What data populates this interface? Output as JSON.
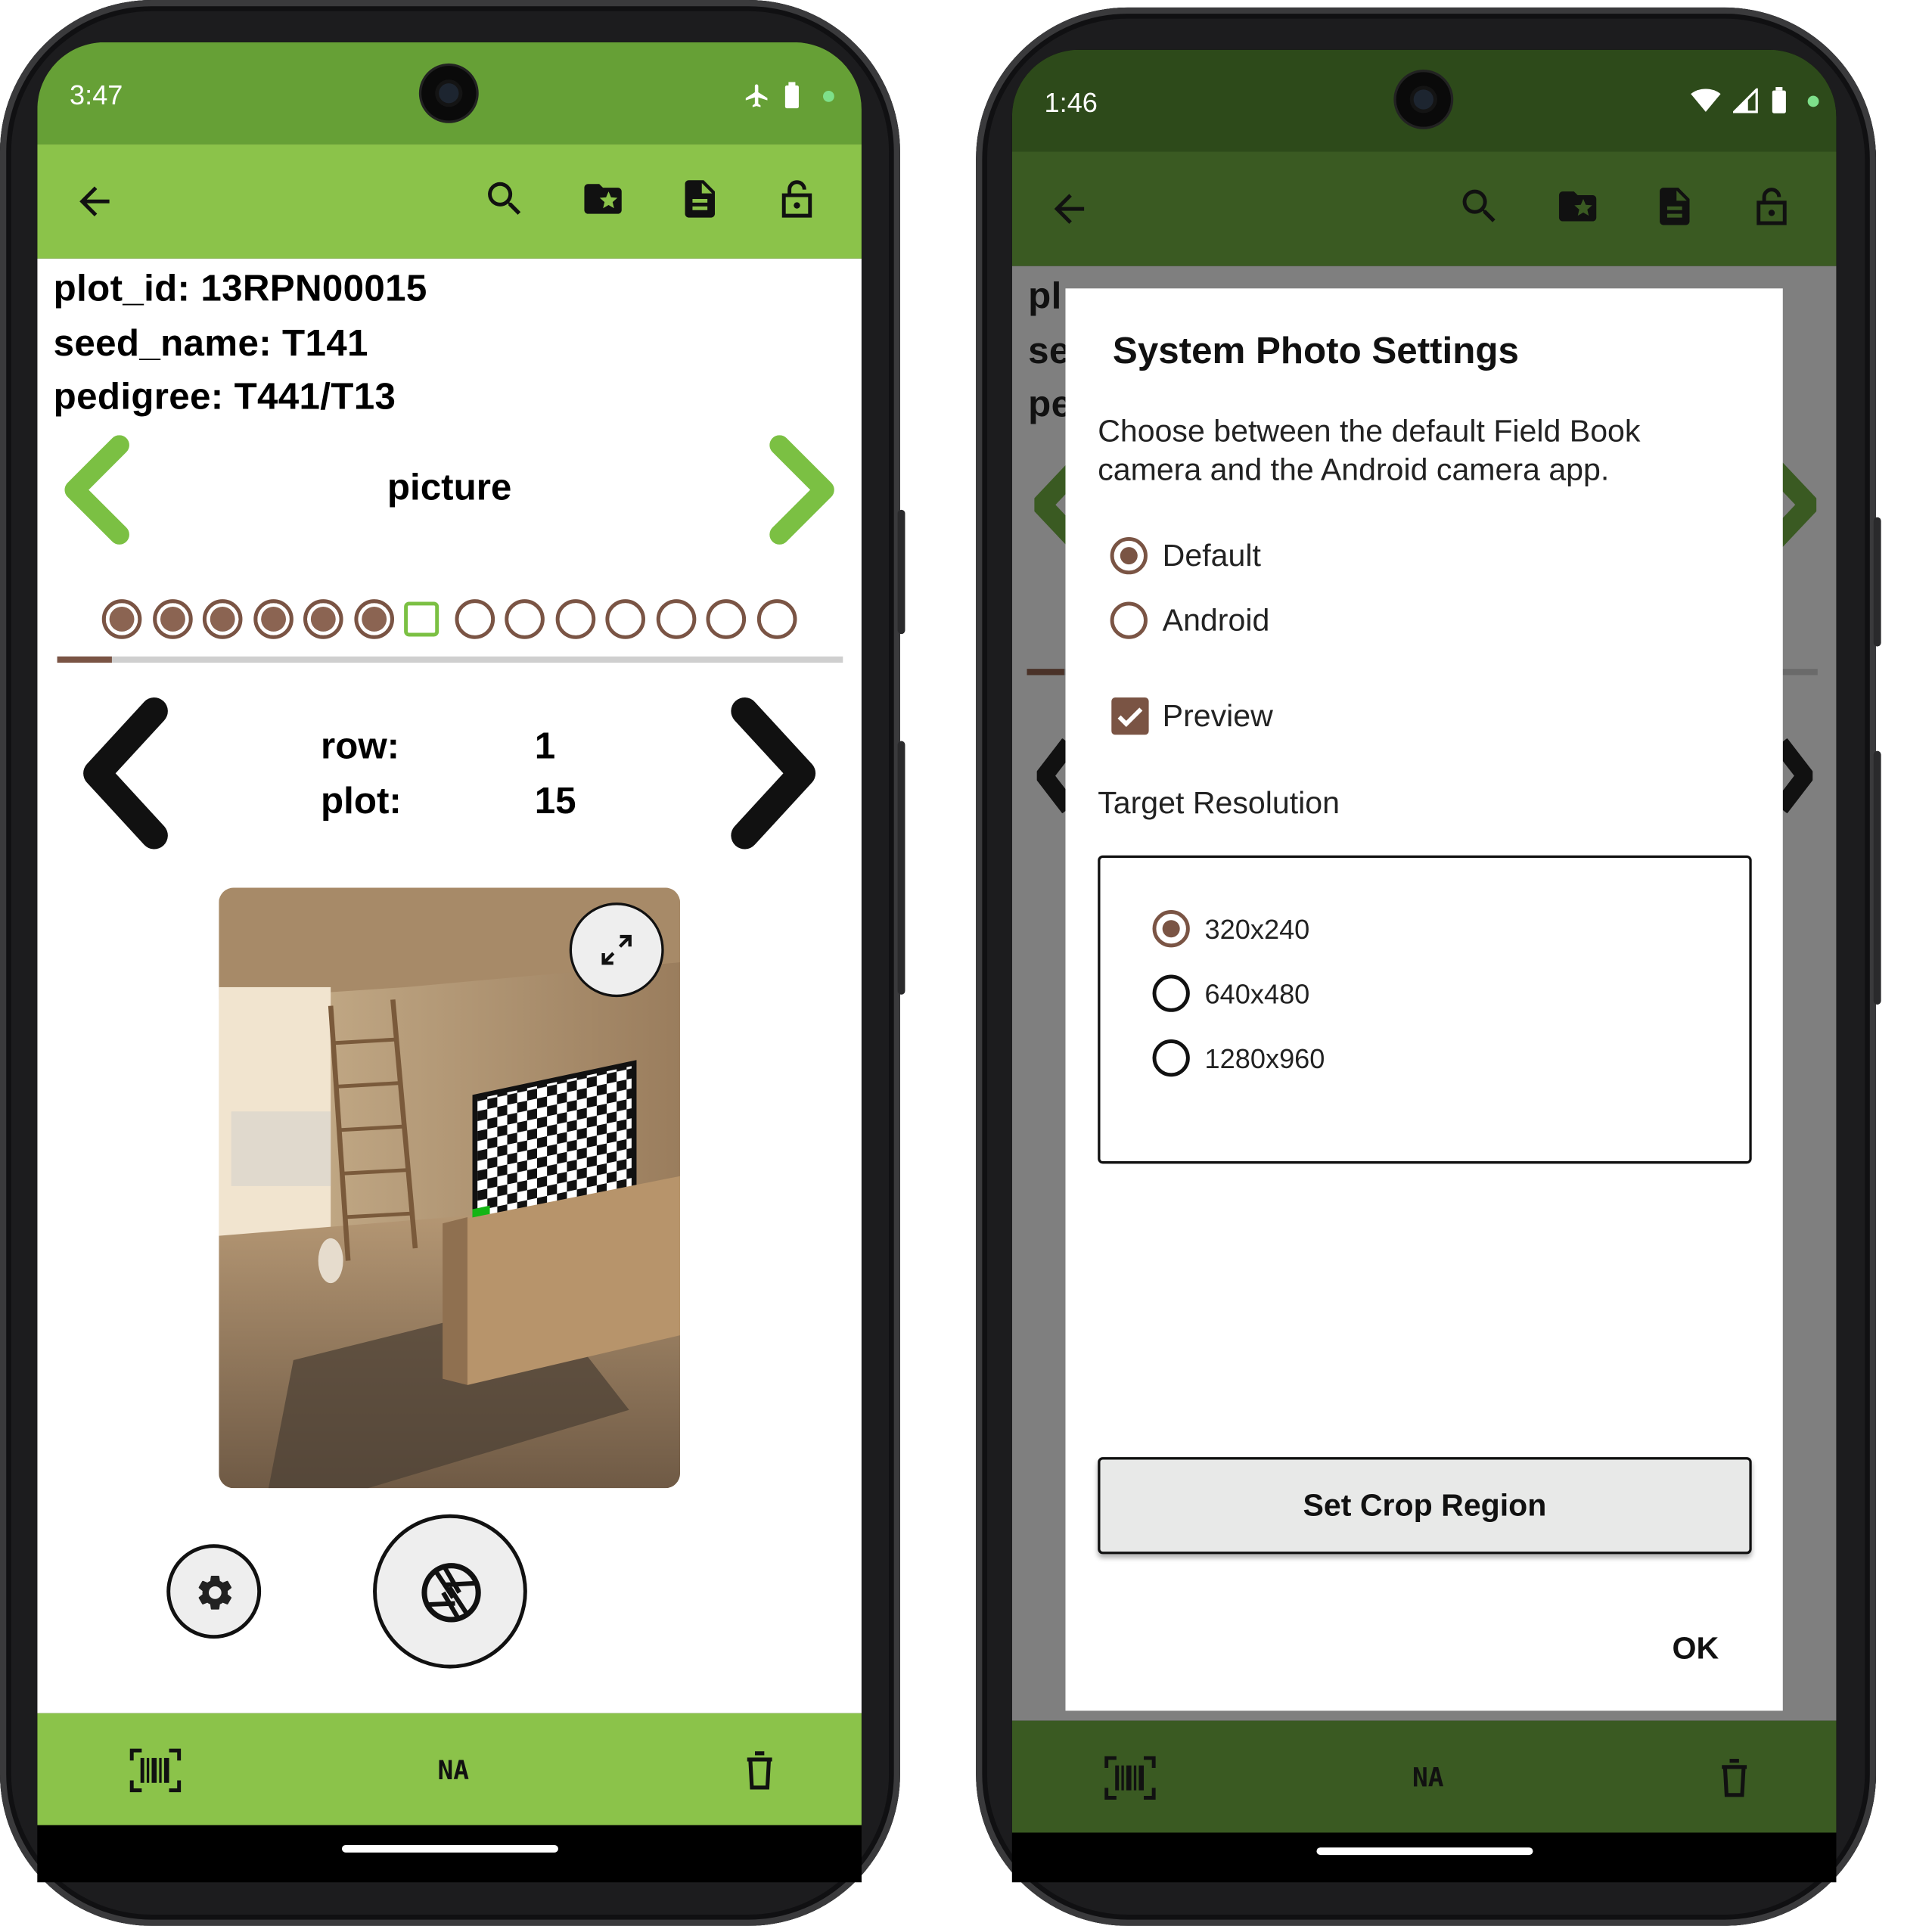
{
  "left_phone": {
    "status_time": "3:47",
    "info": {
      "plot_id": "plot_id: 13RPN00015",
      "seed_name": "seed_name: T141",
      "pedigree": "pedigree: T441/T13"
    },
    "trait_name": "picture",
    "trait_dots": {
      "filled": 6,
      "current_index": 6,
      "total": 14
    },
    "progress_fraction": 0.07,
    "range": {
      "row_label": "row:",
      "row_value": "1",
      "plot_label": "plot:",
      "plot_value": "15"
    },
    "bottom_na": "NA",
    "colors": {
      "status": "#66a036",
      "toolbar": "#8bc34a",
      "accent": "#7bc043"
    }
  },
  "right_phone": {
    "status_time": "1:46",
    "dialog": {
      "title": "System Photo Settings",
      "description": "Choose between the default Field Book camera and the Android camera app.",
      "camera_options": [
        {
          "label": "Default",
          "selected": true
        },
        {
          "label": "Android",
          "selected": false
        }
      ],
      "preview_label": "Preview",
      "preview_checked": true,
      "resolution_title": "Target Resolution",
      "resolutions": [
        {
          "label": "320x240",
          "selected": true
        },
        {
          "label": "640x480",
          "selected": false
        },
        {
          "label": "1280x960",
          "selected": false
        }
      ],
      "crop_button": "Set Crop Region",
      "ok_button": "OK"
    },
    "bottom_na": "NA",
    "colors": {
      "status": "#2d4a1a",
      "toolbar": "#3a5a22",
      "scrim": "#7f7f7f"
    }
  },
  "icons": [
    "back-arrow-icon",
    "search-icon",
    "folder-star-icon",
    "document-icon",
    "unlock-icon",
    "chevron-left-icon",
    "chevron-right-icon",
    "expand-icon",
    "gear-icon",
    "camera-shutter-icon",
    "barcode-icon",
    "trash-icon",
    "airplane-icon",
    "battery-icon",
    "wifi-icon",
    "signal-icon"
  ]
}
